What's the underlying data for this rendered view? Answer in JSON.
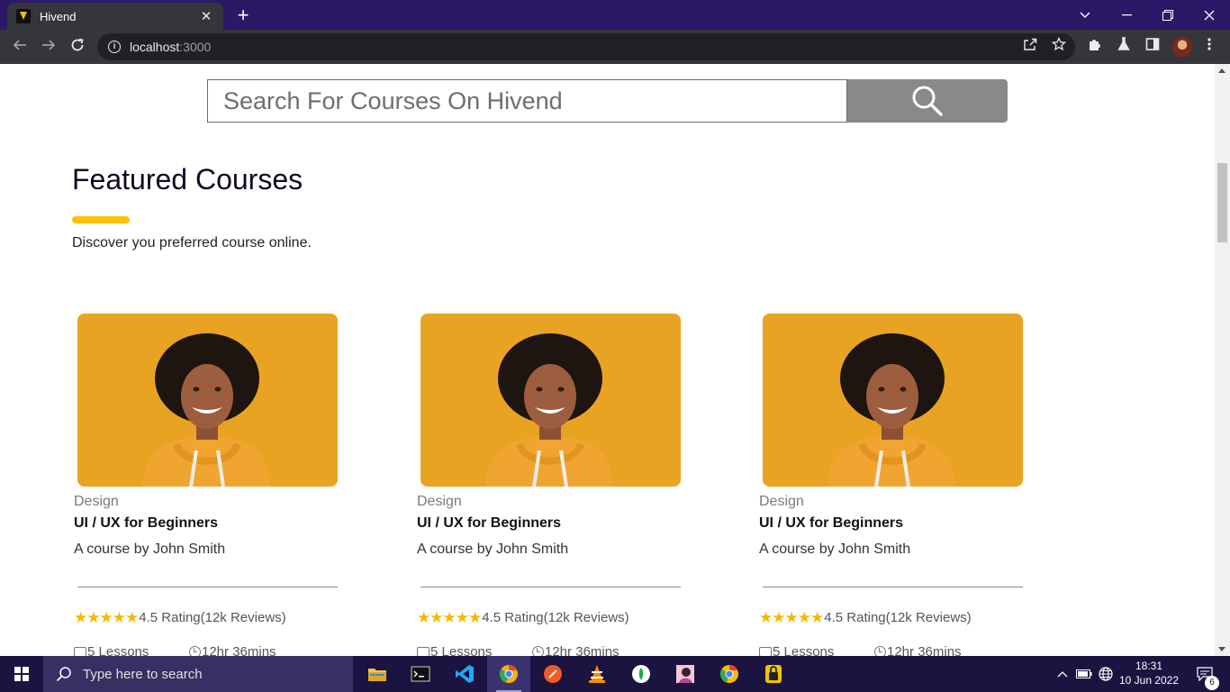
{
  "browser": {
    "tab_title": "Hivend",
    "tab_close": "✕",
    "new_tab": "+",
    "url_host": "localhost",
    "url_port": ":3000"
  },
  "page": {
    "search": {
      "placeholder": "Search For Courses On Hivend"
    },
    "section": {
      "title": "Featured Courses",
      "subtitle": "Discover you preferred course online.",
      "accent_color": "#ffc107"
    },
    "courses": [
      {
        "category": "Design",
        "title": "UI / UX for Beginners",
        "author": "A course by John Smith",
        "rating_text": "4.5 Rating(12k Reviews)",
        "stars": 5,
        "lessons": "5 Lessons",
        "duration": "12hr 36mins"
      },
      {
        "category": "Design",
        "title": "UI / UX for Beginners",
        "author": "A course by John Smith",
        "rating_text": "4.5 Rating(12k Reviews)",
        "stars": 5,
        "lessons": "5 Lessons",
        "duration": "12hr 36mins"
      },
      {
        "category": "Design",
        "title": "UI / UX for Beginners",
        "author": "A course by John Smith",
        "rating_text": "4.5 Rating(12k Reviews)",
        "stars": 5,
        "lessons": "5 Lessons",
        "duration": "12hr 36mins"
      }
    ]
  },
  "taskbar": {
    "search_placeholder": "Type here to search",
    "time": "18:31",
    "date": "10 Jun 2022",
    "notification_count": "6"
  }
}
